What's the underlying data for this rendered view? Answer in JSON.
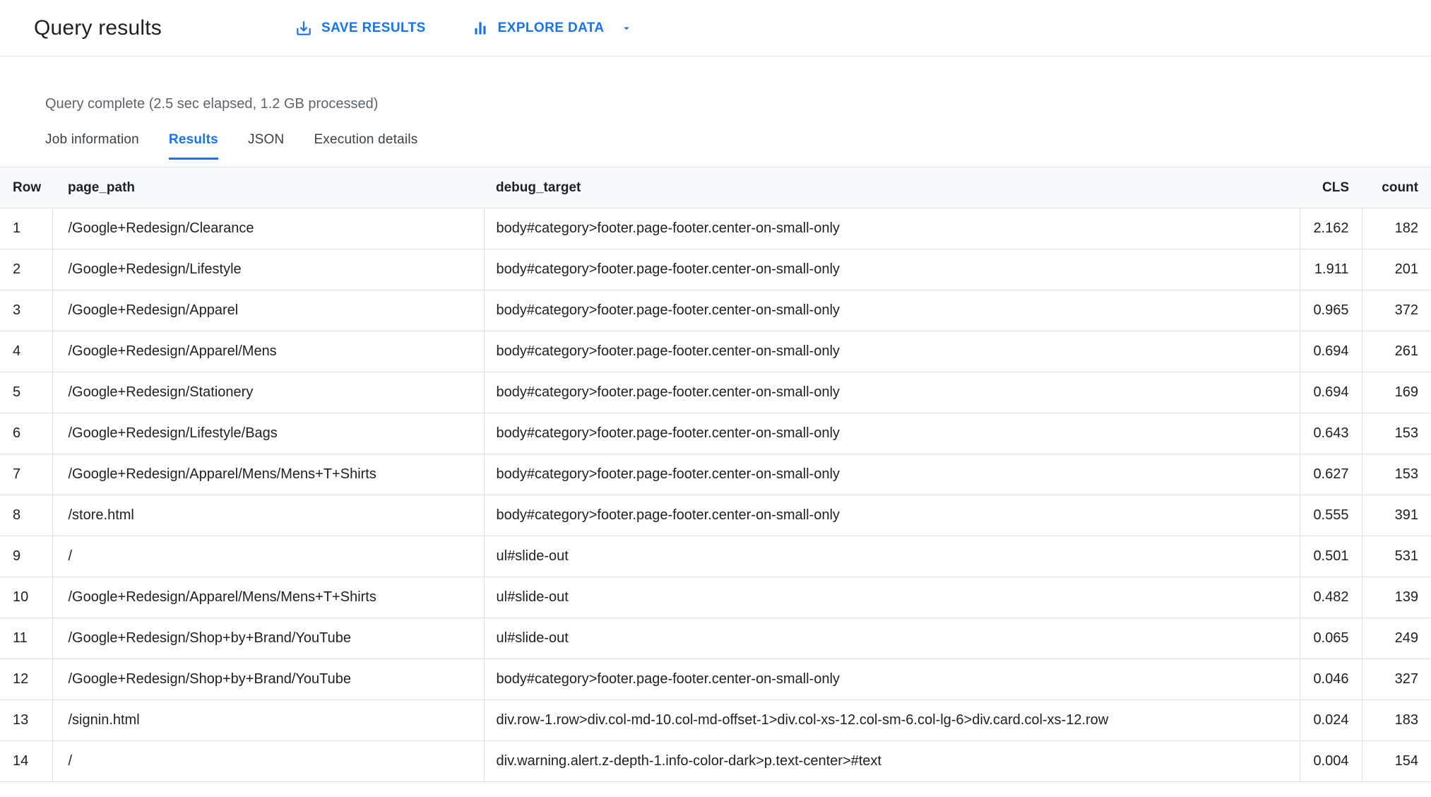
{
  "header": {
    "title": "Query results",
    "save_results_label": "SAVE RESULTS",
    "explore_data_label": "EXPLORE DATA"
  },
  "status_line": "Query complete (2.5 sec elapsed, 1.2 GB processed)",
  "tabs": [
    {
      "label": "Job information",
      "active": false
    },
    {
      "label": "Results",
      "active": true
    },
    {
      "label": "JSON",
      "active": false
    },
    {
      "label": "Execution details",
      "active": false
    }
  ],
  "table": {
    "columns": [
      "Row",
      "page_path",
      "debug_target",
      "CLS",
      "count"
    ],
    "rows": [
      {
        "row": "1",
        "page_path": "/Google+Redesign/Clearance",
        "debug_target": "body#category>footer.page-footer.center-on-small-only",
        "cls": "2.162",
        "count": "182"
      },
      {
        "row": "2",
        "page_path": "/Google+Redesign/Lifestyle",
        "debug_target": "body#category>footer.page-footer.center-on-small-only",
        "cls": "1.911",
        "count": "201"
      },
      {
        "row": "3",
        "page_path": "/Google+Redesign/Apparel",
        "debug_target": "body#category>footer.page-footer.center-on-small-only",
        "cls": "0.965",
        "count": "372"
      },
      {
        "row": "4",
        "page_path": "/Google+Redesign/Apparel/Mens",
        "debug_target": "body#category>footer.page-footer.center-on-small-only",
        "cls": "0.694",
        "count": "261"
      },
      {
        "row": "5",
        "page_path": "/Google+Redesign/Stationery",
        "debug_target": "body#category>footer.page-footer.center-on-small-only",
        "cls": "0.694",
        "count": "169"
      },
      {
        "row": "6",
        "page_path": "/Google+Redesign/Lifestyle/Bags",
        "debug_target": "body#category>footer.page-footer.center-on-small-only",
        "cls": "0.643",
        "count": "153"
      },
      {
        "row": "7",
        "page_path": "/Google+Redesign/Apparel/Mens/Mens+T+Shirts",
        "debug_target": "body#category>footer.page-footer.center-on-small-only",
        "cls": "0.627",
        "count": "153"
      },
      {
        "row": "8",
        "page_path": "/store.html",
        "debug_target": "body#category>footer.page-footer.center-on-small-only",
        "cls": "0.555",
        "count": "391"
      },
      {
        "row": "9",
        "page_path": "/",
        "debug_target": "ul#slide-out",
        "cls": "0.501",
        "count": "531"
      },
      {
        "row": "10",
        "page_path": "/Google+Redesign/Apparel/Mens/Mens+T+Shirts",
        "debug_target": "ul#slide-out",
        "cls": "0.482",
        "count": "139"
      },
      {
        "row": "11",
        "page_path": "/Google+Redesign/Shop+by+Brand/YouTube",
        "debug_target": "ul#slide-out",
        "cls": "0.065",
        "count": "249"
      },
      {
        "row": "12",
        "page_path": "/Google+Redesign/Shop+by+Brand/YouTube",
        "debug_target": "body#category>footer.page-footer.center-on-small-only",
        "cls": "0.046",
        "count": "327"
      },
      {
        "row": "13",
        "page_path": "/signin.html",
        "debug_target": "div.row-1.row>div.col-md-10.col-md-offset-1>div.col-xs-12.col-sm-6.col-lg-6>div.card.col-xs-12.row",
        "cls": "0.024",
        "count": "183"
      },
      {
        "row": "14",
        "page_path": "/",
        "debug_target": "div.warning.alert.z-depth-1.info-color-dark>p.text-center>#text",
        "cls": "0.004",
        "count": "154"
      }
    ]
  },
  "icons": {
    "save": "download-tray-icon",
    "explore": "bar-chart-icon",
    "explore_caret": "▼"
  },
  "colors": {
    "accent": "#1a73e8",
    "text": "#202124",
    "muted": "#5f6368",
    "border": "#e0e0e0",
    "table_header_bg": "#f8f9fa"
  }
}
